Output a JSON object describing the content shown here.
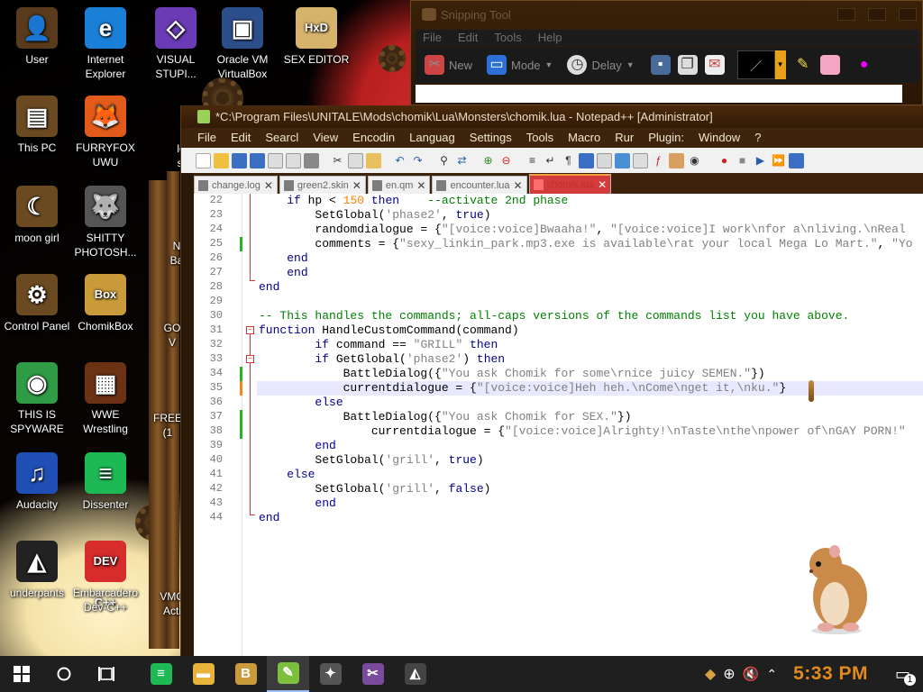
{
  "desktop": {
    "icons": [
      {
        "label": "User",
        "glyph": "👤",
        "bg": "#5a3a1c"
      },
      {
        "label": "Internet Explorer",
        "glyph": "e",
        "bg": "#1a7fd6"
      },
      {
        "label": "VISUAL STUPI...",
        "glyph": "◇",
        "bg": "#6a3bb5"
      },
      {
        "label": "Oracle VM VirtualBox",
        "glyph": "▣",
        "bg": "#2c4f8c"
      },
      {
        "label": "SEX EDITOR",
        "glyph": "HxD",
        "bg": "#d6b36a"
      },
      {
        "label": "This PC",
        "glyph": "▤",
        "bg": "#6b4a22"
      },
      {
        "label": "FURRYFOX UWU",
        "glyph": "🦊",
        "bg": "#e25b1a"
      },
      {
        "label": "moon girl",
        "glyph": "☾",
        "bg": "#6b4a22"
      },
      {
        "label": "SHITTY PHOTOSH...",
        "glyph": "🐺",
        "bg": "#555555"
      },
      {
        "label": "Control Panel",
        "glyph": "⚙",
        "bg": "#6b4a22"
      },
      {
        "label": "ChomikBox",
        "glyph": "Box",
        "bg": "#c99b3a"
      },
      {
        "label": "THIS IS SPYWARE",
        "glyph": "◉",
        "bg": "#2f9c45"
      },
      {
        "label": "WWE Wrestling",
        "glyph": "▦",
        "bg": "#6b3314"
      },
      {
        "label": "Audacity",
        "glyph": "♫",
        "bg": "#1f4fb5"
      },
      {
        "label": "Dissenter",
        "glyph": "≡",
        "bg": "#1db954"
      },
      {
        "label": "underpants",
        "glyph": "◭",
        "bg": "#222222"
      },
      {
        "label": "Embarcadero Dev-C++",
        "glyph": "DEV C++",
        "bg": "#d62c2c"
      }
    ],
    "partial_labels": [
      "loc",
      "ski",
      "N",
      "Ba",
      "GO",
      "V",
      "FREE",
      "(1",
      "VMO",
      "Acti"
    ]
  },
  "snipping_tool": {
    "title": "Snipping Tool",
    "menu": [
      "File",
      "Edit",
      "Tools",
      "Help"
    ],
    "toolbar": [
      {
        "label": "New",
        "icon": "scissors-icon"
      },
      {
        "label": "Mode",
        "icon": "mode-icon"
      },
      {
        "label": "Delay",
        "icon": "clock-icon"
      }
    ]
  },
  "notepadpp": {
    "title": "*C:\\Program Files\\UNITALE\\Mods\\chomik\\Lua\\Monsters\\chomik.lua - Notepad++ [Administrator]",
    "menu": [
      "File",
      "Edit",
      "Searcl",
      "View",
      "Encodin",
      "Languag",
      "Settings",
      "Tools",
      "Macro",
      "Rur",
      "Plugin:",
      "Window",
      "?"
    ],
    "tabs": [
      {
        "label": "change.log",
        "active": false
      },
      {
        "label": "green2.skin",
        "active": false
      },
      {
        "label": "en.qm",
        "active": false
      },
      {
        "label": "encounter.lua",
        "active": false
      },
      {
        "label": "chomik.lua",
        "active": true
      }
    ],
    "line_numbers": [
      "22",
      "23",
      "24",
      "25",
      "26",
      "27",
      "28",
      "29",
      "30",
      "31",
      "32",
      "33",
      "34",
      "35",
      "36",
      "37",
      "38",
      "39",
      "40",
      "41",
      "42",
      "43",
      "44"
    ]
  },
  "taskbar": {
    "clock": "5:33 PM",
    "notification_count": "1",
    "apps": [
      {
        "name": "dissenter",
        "glyph": "≡",
        "bg": "#1db954"
      },
      {
        "name": "file-explorer",
        "glyph": "▬",
        "bg": "#e8b33a"
      },
      {
        "name": "chomikbox",
        "glyph": "B",
        "bg": "#c99b3a"
      },
      {
        "name": "notepadpp",
        "glyph": "✎",
        "bg": "#7cbf3c"
      },
      {
        "name": "shitty-photoshop",
        "glyph": "✦",
        "bg": "#555555"
      },
      {
        "name": "snipping-tool",
        "glyph": "✂",
        "bg": "#7a4b9c"
      },
      {
        "name": "unity",
        "glyph": "◭",
        "bg": "#444444"
      }
    ]
  },
  "colors": {
    "accent": "#e18a1e",
    "tab_active": "#d43b3b",
    "keyword": "#00008b",
    "string": "#808080",
    "comment": "#008000"
  }
}
